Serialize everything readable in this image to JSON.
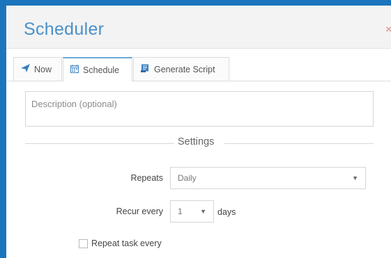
{
  "dialog": {
    "title": "Scheduler",
    "close_glyph": "×"
  },
  "tabs": [
    {
      "label": "Now",
      "icon": "send-icon"
    },
    {
      "label": "Schedule",
      "icon": "calendar-icon"
    },
    {
      "label": "Generate Script",
      "icon": "script-icon"
    }
  ],
  "description": {
    "placeholder": "Description (optional)",
    "value": ""
  },
  "settings": {
    "heading": "Settings",
    "repeats_label": "Repeats",
    "repeats_value": "Daily",
    "recur_label": "Recur every",
    "recur_value": "1",
    "recur_unit": "days",
    "repeat_task_label": "Repeat task every",
    "repeat_task_checked": false
  },
  "colors": {
    "frame_border": "#1b75bc",
    "title_text": "#4a90c8",
    "tab_icon": "#3b7fc0"
  }
}
